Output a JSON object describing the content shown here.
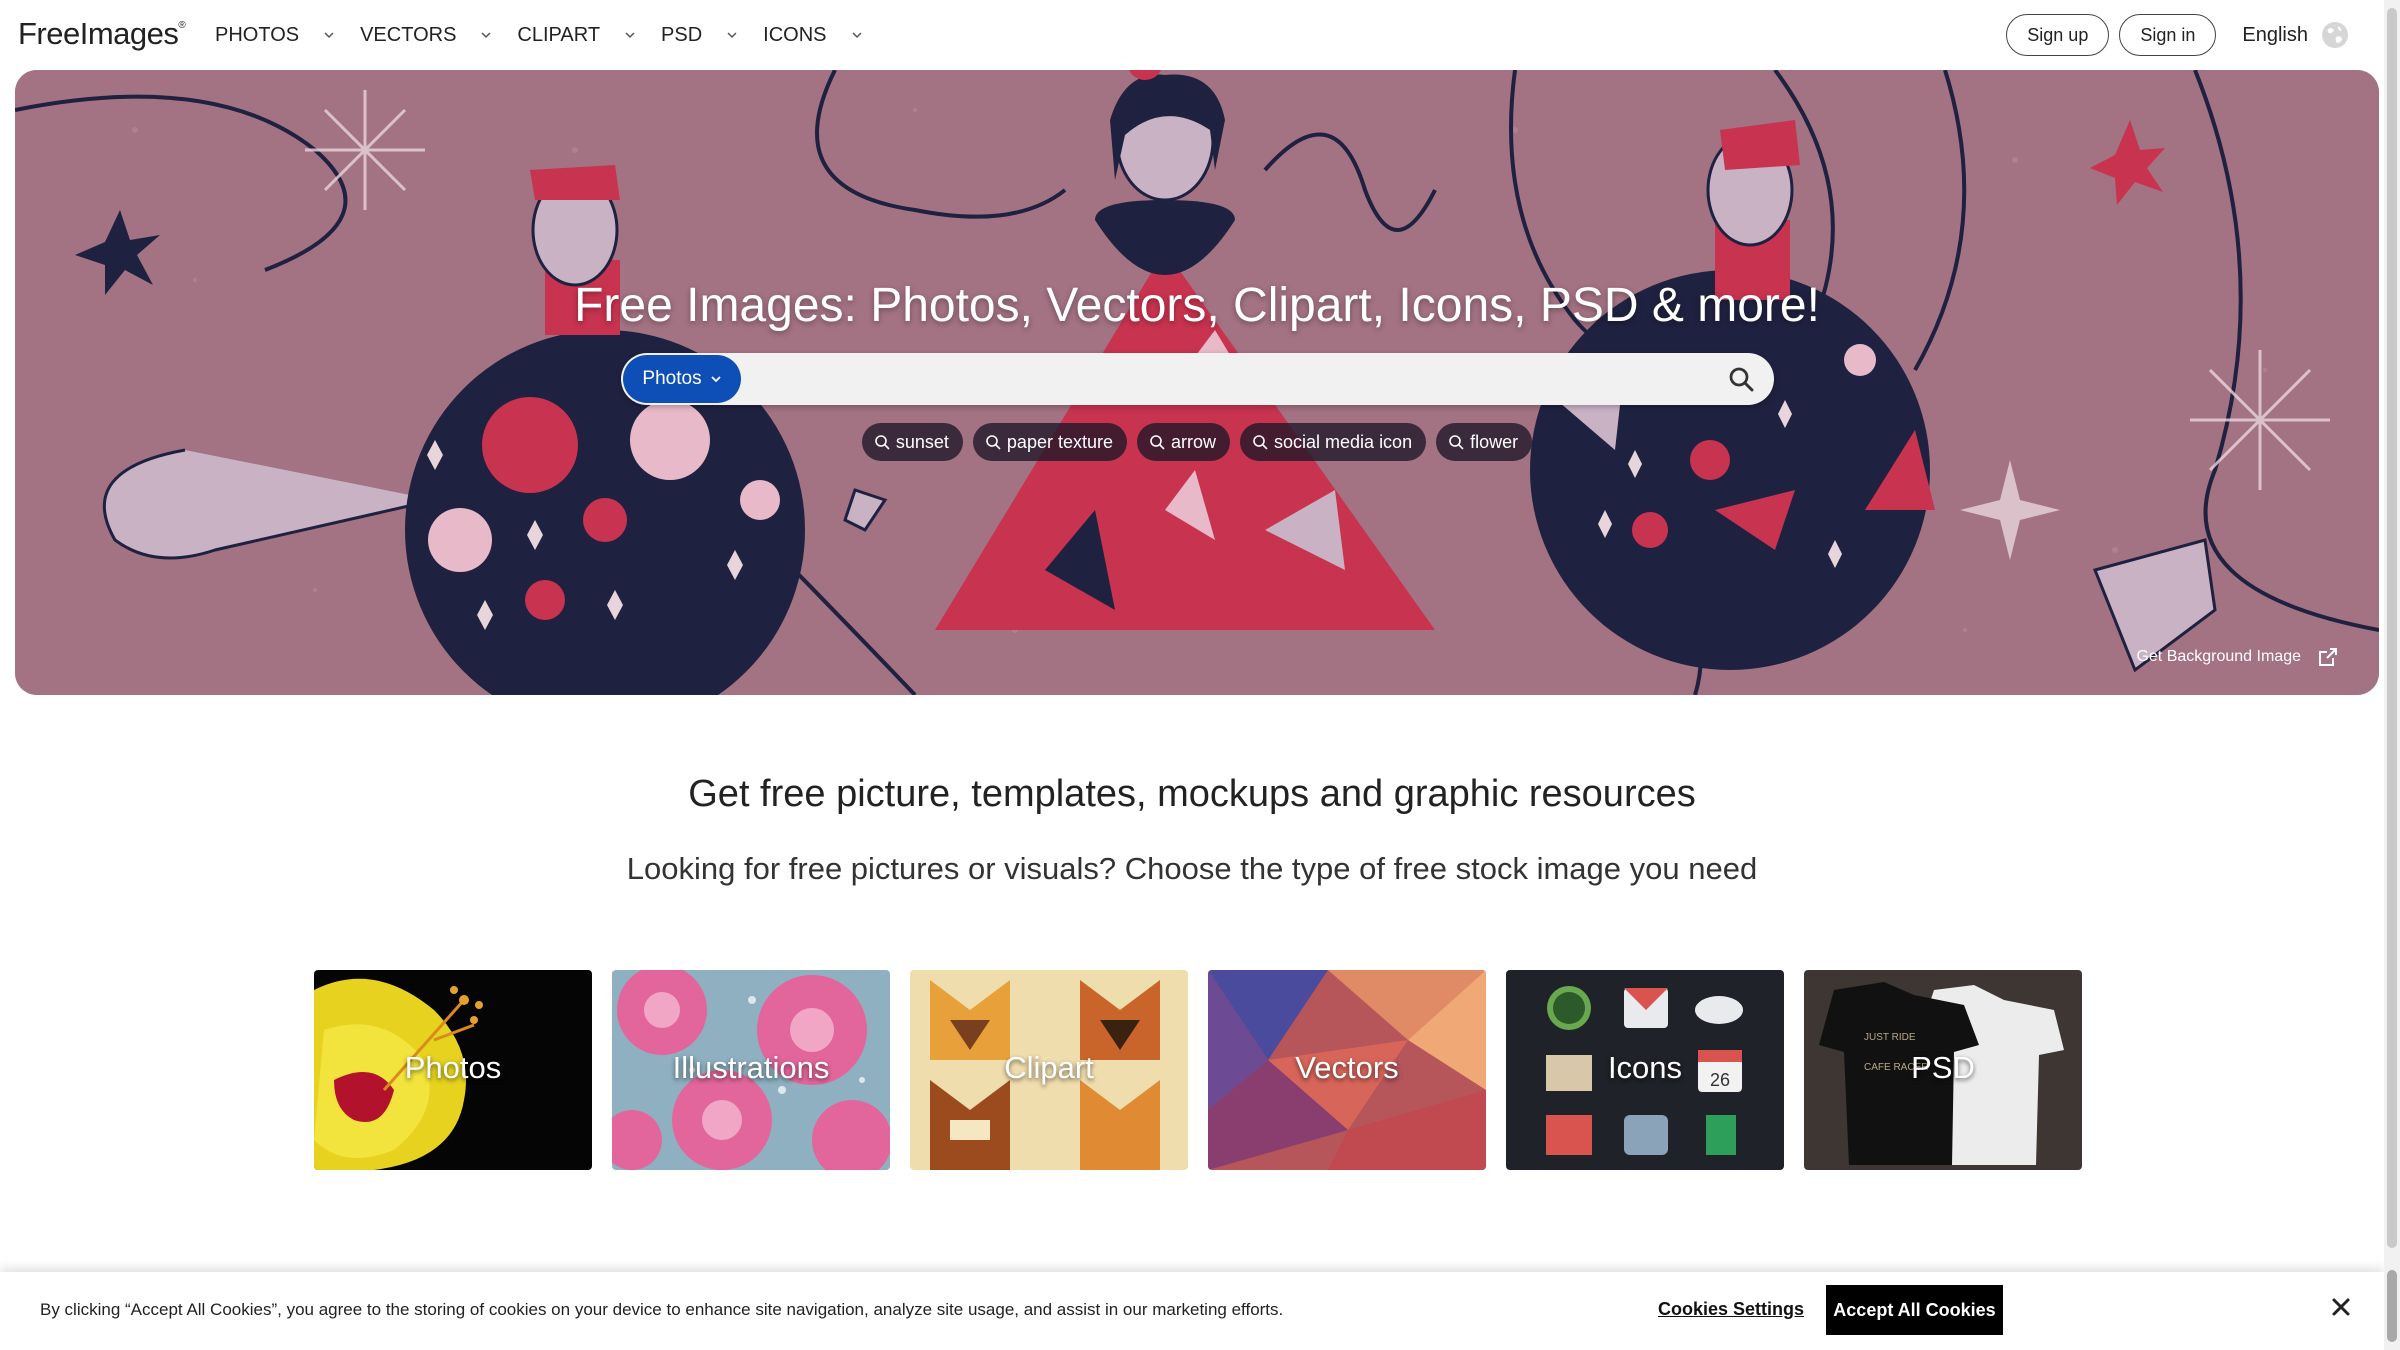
{
  "header": {
    "logo": "FreeImages",
    "logo_mark": "®",
    "nav": [
      {
        "label": "PHOTOS"
      },
      {
        "label": "VECTORS"
      },
      {
        "label": "CLIPART"
      },
      {
        "label": "PSD"
      },
      {
        "label": "ICONS"
      }
    ],
    "sign_up": "Sign up",
    "sign_in": "Sign in",
    "language": "English"
  },
  "hero": {
    "title": "Free Images: Photos, Vectors, Clipart, Icons, PSD & more!",
    "search_type": "Photos",
    "search_placeholder": "",
    "tags": [
      "sunset",
      "paper texture",
      "arrow",
      "social media icon",
      "flower"
    ],
    "get_background": "Get Background Image",
    "background_color": "#a37283"
  },
  "section": {
    "title": "Get free picture, templates, mockups and graphic resources",
    "subtitle": "Looking for free pictures or visuals? Choose the type of free stock image you need"
  },
  "categories": [
    {
      "label": "Photos"
    },
    {
      "label": "Illustrations"
    },
    {
      "label": "Clipart"
    },
    {
      "label": "Vectors"
    },
    {
      "label": "Icons"
    },
    {
      "label": "PSD"
    }
  ],
  "cookie": {
    "text": "By clicking “Accept All Cookies”, you agree to the storing of cookies on your device to enhance site navigation, analyze site usage, and assist in our marketing efforts.",
    "settings": "Cookies Settings",
    "accept": "Accept All Cookies"
  },
  "colors": {
    "accent": "#0e4fb7",
    "hero_navy": "#1f2140",
    "hero_red": "#c8334f"
  }
}
